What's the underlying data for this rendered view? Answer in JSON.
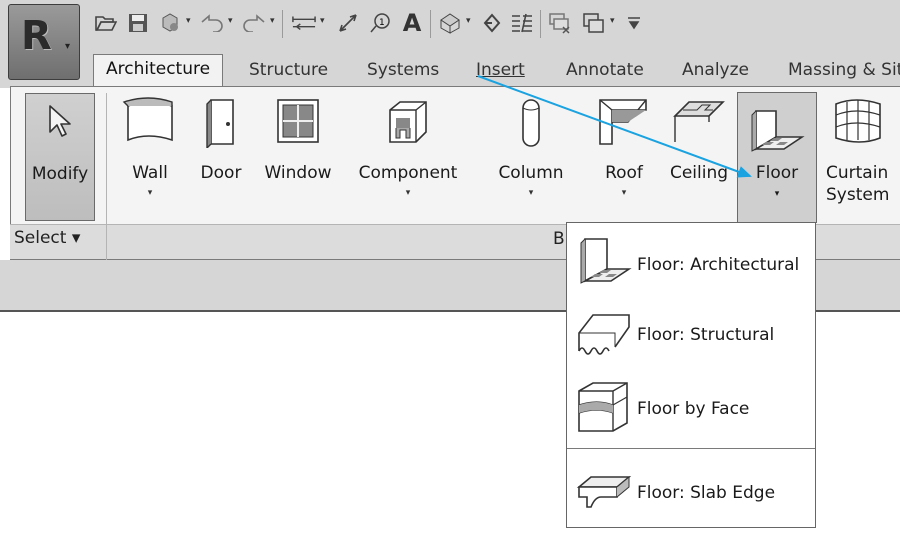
{
  "app": {
    "logo_letter": "R",
    "menu_caret": "▾"
  },
  "quick_access": {
    "icons": [
      "open-icon",
      "save-icon",
      "sync-icon",
      "undo-icon",
      "redo-icon",
      "measure-icon",
      "dimension-icon",
      "tag-icon",
      "text-icon",
      "3d-view-icon",
      "section-icon",
      "thin-lines-icon",
      "close-views-icon",
      "switch-windows-icon",
      "customize-icon"
    ]
  },
  "tabs": [
    {
      "label": "Architecture",
      "active": true
    },
    {
      "label": "Structure"
    },
    {
      "label": "Systems"
    },
    {
      "label": "Insert"
    },
    {
      "label": "Annotate"
    },
    {
      "label": "Analyze"
    },
    {
      "label": "Massing & Sit"
    }
  ],
  "ribbon": {
    "modify_label": "Modify",
    "select_label": "Select",
    "select_caret": "▾",
    "panel_label": "B",
    "tools": {
      "wall": "Wall",
      "door": "Door",
      "window": "Window",
      "component": "Component",
      "column": "Column",
      "roof": "Roof",
      "ceiling": "Ceiling",
      "floor": "Floor",
      "curtain_line1": "Curtain",
      "curtain_line2": "System"
    },
    "dropdown_caret": "▾"
  },
  "floor_menu": {
    "items": [
      {
        "label": "Floor: Architectural",
        "icon": "floor-architectural-icon"
      },
      {
        "label": "Floor: Structural",
        "icon": "floor-structural-icon"
      },
      {
        "label": "Floor by Face",
        "icon": "floor-by-face-icon"
      },
      {
        "label": "Floor: Slab Edge",
        "icon": "floor-slab-edge-icon"
      }
    ]
  },
  "colors": {
    "ribbon_bg": "#f4f4f4",
    "toolbar_bg": "#d6d6d6",
    "callout_arrow": "#1aa3e0"
  }
}
